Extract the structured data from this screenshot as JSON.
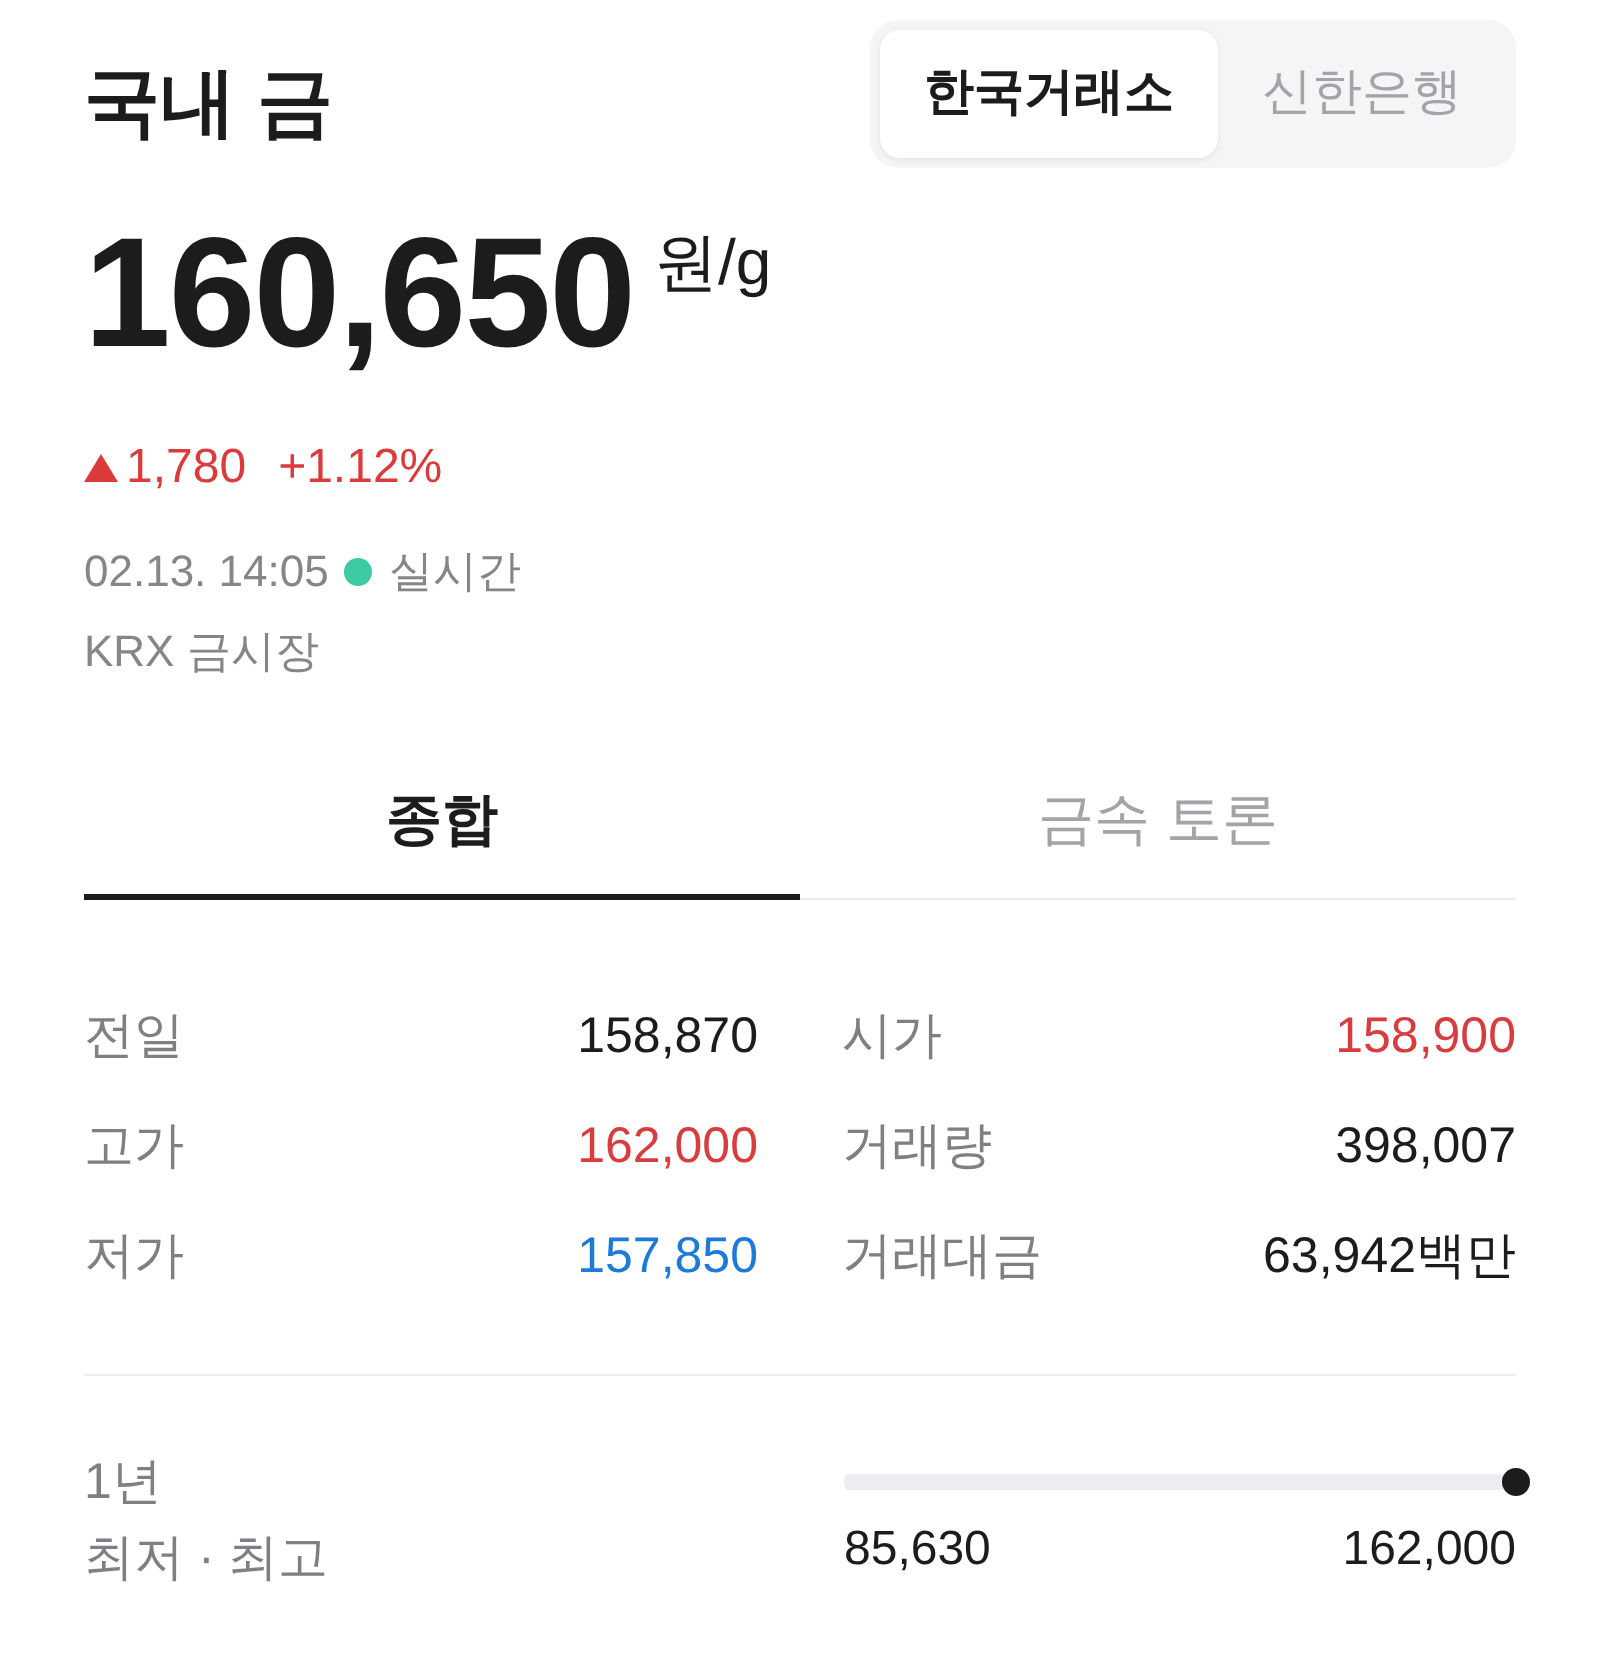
{
  "header": {
    "title": "국내 금",
    "exchanges": [
      {
        "label": "한국거래소",
        "selected": true
      },
      {
        "label": "신한은행",
        "selected": false
      }
    ]
  },
  "price": {
    "value": "160,650",
    "unit": "원/g"
  },
  "change": {
    "up": true,
    "amount": "1,780",
    "percent": "+1.12%"
  },
  "status": {
    "time": "02.13. 14:05",
    "live_label": "실시간",
    "market": "KRX 금시장"
  },
  "tabs": [
    {
      "label": "종합",
      "selected": true
    },
    {
      "label": "금속 토론",
      "selected": false
    }
  ],
  "stats": [
    {
      "label": "전일",
      "value": "158,870",
      "color": "#1c1c1e"
    },
    {
      "label": "시가",
      "value": "158,900",
      "color": "#d93c3c"
    },
    {
      "label": "고가",
      "value": "162,000",
      "color": "#d93c3c"
    },
    {
      "label": "거래량",
      "value": "398,007",
      "color": "#1c1c1e"
    },
    {
      "label": "저가",
      "value": "157,850",
      "color": "#1d7ad8"
    },
    {
      "label": "거래대금",
      "value": "63,942백만",
      "color": "#1c1c1e"
    }
  ],
  "range": {
    "period": "1년",
    "label": "최저 · 최고",
    "level": 1,
    "low": "85,630",
    "high": "162,000"
  }
}
